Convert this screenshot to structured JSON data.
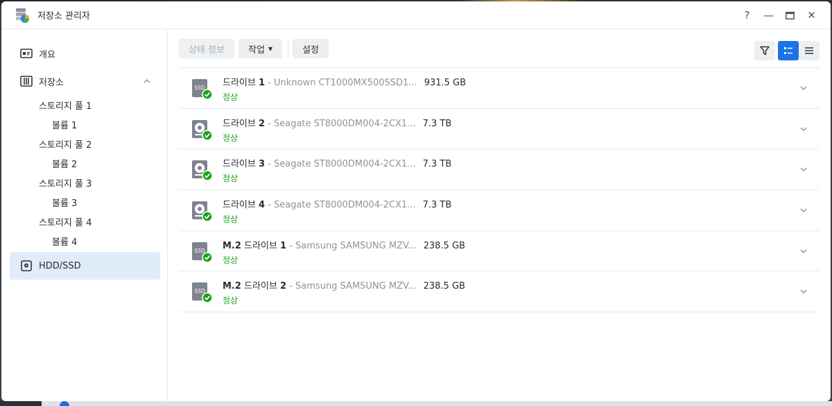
{
  "window": {
    "title": "저장소 관리자",
    "controls": {
      "help": "?",
      "minimize": "—",
      "maximize": "▭",
      "close": "✕"
    }
  },
  "sidebar": {
    "overview_label": "개요",
    "storage_label": "저장소",
    "storage_pools": [
      {
        "pool": "스토리지 풀 1",
        "volume": "볼륨 1"
      },
      {
        "pool": "스토리지 풀 2",
        "volume": "볼륨 2"
      },
      {
        "pool": "스토리지 풀 3",
        "volume": "볼륨 3"
      },
      {
        "pool": "스토리지 풀 4",
        "volume": "볼륨 4"
      }
    ],
    "hdd_ssd_label": "HDD/SSD",
    "active_item": "HDD/SSD"
  },
  "toolbar": {
    "status_info_label": "상태 정보",
    "action_label": "작업",
    "settings_label": "설정"
  },
  "drives": [
    {
      "prefix": "",
      "name": "드라이브",
      "num": "1",
      "model": " - Unknown CT1000MX500SSD1...",
      "size": "931.5 GB",
      "status": "정상",
      "type": "ssd"
    },
    {
      "prefix": "",
      "name": "드라이브",
      "num": "2",
      "model": " - Seagate ST8000DM004-2CX1...",
      "size": "7.3 TB",
      "status": "정상",
      "type": "hdd"
    },
    {
      "prefix": "",
      "name": "드라이브",
      "num": "3",
      "model": " - Seagate ST8000DM004-2CX1...",
      "size": "7.3 TB",
      "status": "정상",
      "type": "hdd"
    },
    {
      "prefix": "",
      "name": "드라이브",
      "num": "4",
      "model": " - Seagate ST8000DM004-2CX1...",
      "size": "7.3 TB",
      "status": "정상",
      "type": "hdd"
    },
    {
      "prefix": "M.2",
      "name": "드라이브",
      "num": "1",
      "model": " - Samsung SAMSUNG MZV...",
      "size": "238.5 GB",
      "status": "정상",
      "type": "ssd"
    },
    {
      "prefix": "M.2",
      "name": "드라이브",
      "num": "2",
      "model": " - Samsung SAMSUNG MZV...",
      "size": "238.5 GB",
      "status": "정상",
      "type": "ssd"
    }
  ],
  "icons": {
    "ssd_text": "SSD",
    "app": "storage-manager-icon",
    "status_ok_color": "#18a31a",
    "accent": "#1a73e8"
  }
}
